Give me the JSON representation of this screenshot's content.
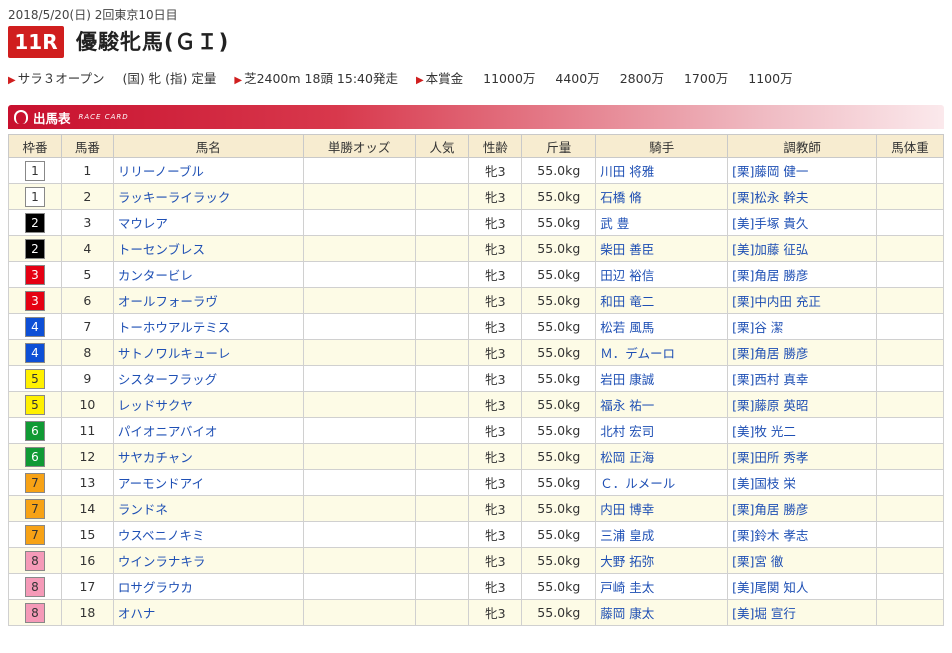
{
  "header": {
    "date_line": "2018/5/20(日) 2回東京10日目",
    "race_number": "11R",
    "race_name": "優駿牝馬(ＧＩ)"
  },
  "conditions": {
    "class": "サラ３オープン",
    "rules": "(国) 牝 (指) 定量",
    "course": "芝2400m 18頭 15:40発走",
    "prize_label": "本賞金",
    "prizes": [
      "11000万",
      "4400万",
      "2800万",
      "1700万",
      "1100万"
    ]
  },
  "section": {
    "title": "出馬表",
    "subtitle": "RACE CARD"
  },
  "columns": [
    "枠番",
    "馬番",
    "馬名",
    "単勝オッズ",
    "人気",
    "性齢",
    "斤量",
    "騎手",
    "調教師",
    "馬体重"
  ],
  "waku_colors": {
    "1": {
      "bg": "#ffffff",
      "fg": "#333333"
    },
    "2": {
      "bg": "#000000",
      "fg": "#ffffff"
    },
    "3": {
      "bg": "#e50012",
      "fg": "#ffffff"
    },
    "4": {
      "bg": "#0d4fd6",
      "fg": "#ffffff"
    },
    "5": {
      "bg": "#fff000",
      "fg": "#333333"
    },
    "6": {
      "bg": "#109a34",
      "fg": "#ffffff"
    },
    "7": {
      "bg": "#f7a215",
      "fg": "#333333"
    },
    "8": {
      "bg": "#f59ab8",
      "fg": "#333333"
    }
  },
  "entries": [
    {
      "waku": "1",
      "umaban": "1",
      "horse": "リリーノーブル",
      "odds": "",
      "pop": "",
      "sex_age": "牝3",
      "weight": "55.0kg",
      "jockey": "川田 将雅",
      "trainer": "[栗]藤岡 健一",
      "body": ""
    },
    {
      "waku": "1",
      "umaban": "2",
      "horse": "ラッキーライラック",
      "odds": "",
      "pop": "",
      "sex_age": "牝3",
      "weight": "55.0kg",
      "jockey": "石橋 脩",
      "trainer": "[栗]松永 幹夫",
      "body": ""
    },
    {
      "waku": "2",
      "umaban": "3",
      "horse": "マウレア",
      "odds": "",
      "pop": "",
      "sex_age": "牝3",
      "weight": "55.0kg",
      "jockey": "武 豊",
      "trainer": "[美]手塚 貴久",
      "body": ""
    },
    {
      "waku": "2",
      "umaban": "4",
      "horse": "トーセンブレス",
      "odds": "",
      "pop": "",
      "sex_age": "牝3",
      "weight": "55.0kg",
      "jockey": "柴田 善臣",
      "trainer": "[美]加藤 征弘",
      "body": ""
    },
    {
      "waku": "3",
      "umaban": "5",
      "horse": "カンタービレ",
      "odds": "",
      "pop": "",
      "sex_age": "牝3",
      "weight": "55.0kg",
      "jockey": "田辺 裕信",
      "trainer": "[栗]角居 勝彦",
      "body": ""
    },
    {
      "waku": "3",
      "umaban": "6",
      "horse": "オールフォーラヴ",
      "odds": "",
      "pop": "",
      "sex_age": "牝3",
      "weight": "55.0kg",
      "jockey": "和田 竜二",
      "trainer": "[栗]中内田 充正",
      "body": ""
    },
    {
      "waku": "4",
      "umaban": "7",
      "horse": "トーホウアルテミス",
      "odds": "",
      "pop": "",
      "sex_age": "牝3",
      "weight": "55.0kg",
      "jockey": "松若 風馬",
      "trainer": "[栗]谷 潔",
      "body": ""
    },
    {
      "waku": "4",
      "umaban": "8",
      "horse": "サトノワルキューレ",
      "odds": "",
      "pop": "",
      "sex_age": "牝3",
      "weight": "55.0kg",
      "jockey": "Ｍ．デムーロ",
      "trainer": "[栗]角居 勝彦",
      "body": ""
    },
    {
      "waku": "5",
      "umaban": "9",
      "horse": "シスターフラッグ",
      "odds": "",
      "pop": "",
      "sex_age": "牝3",
      "weight": "55.0kg",
      "jockey": "岩田 康誠",
      "trainer": "[栗]西村 真幸",
      "body": ""
    },
    {
      "waku": "5",
      "umaban": "10",
      "horse": "レッドサクヤ",
      "odds": "",
      "pop": "",
      "sex_age": "牝3",
      "weight": "55.0kg",
      "jockey": "福永 祐一",
      "trainer": "[栗]藤原 英昭",
      "body": ""
    },
    {
      "waku": "6",
      "umaban": "11",
      "horse": "パイオニアバイオ",
      "odds": "",
      "pop": "",
      "sex_age": "牝3",
      "weight": "55.0kg",
      "jockey": "北村 宏司",
      "trainer": "[美]牧 光二",
      "body": ""
    },
    {
      "waku": "6",
      "umaban": "12",
      "horse": "サヤカチャン",
      "odds": "",
      "pop": "",
      "sex_age": "牝3",
      "weight": "55.0kg",
      "jockey": "松岡 正海",
      "trainer": "[栗]田所 秀孝",
      "body": ""
    },
    {
      "waku": "7",
      "umaban": "13",
      "horse": "アーモンドアイ",
      "odds": "",
      "pop": "",
      "sex_age": "牝3",
      "weight": "55.0kg",
      "jockey": "Ｃ．ルメール",
      "trainer": "[美]国枝 栄",
      "body": ""
    },
    {
      "waku": "7",
      "umaban": "14",
      "horse": "ランドネ",
      "odds": "",
      "pop": "",
      "sex_age": "牝3",
      "weight": "55.0kg",
      "jockey": "内田 博幸",
      "trainer": "[栗]角居 勝彦",
      "body": ""
    },
    {
      "waku": "7",
      "umaban": "15",
      "horse": "ウスベニノキミ",
      "odds": "",
      "pop": "",
      "sex_age": "牝3",
      "weight": "55.0kg",
      "jockey": "三浦 皇成",
      "trainer": "[栗]鈴木 孝志",
      "body": ""
    },
    {
      "waku": "8",
      "umaban": "16",
      "horse": "ウインラナキラ",
      "odds": "",
      "pop": "",
      "sex_age": "牝3",
      "weight": "55.0kg",
      "jockey": "大野 拓弥",
      "trainer": "[栗]宮 徹",
      "body": ""
    },
    {
      "waku": "8",
      "umaban": "17",
      "horse": "ロサグラウカ",
      "odds": "",
      "pop": "",
      "sex_age": "牝3",
      "weight": "55.0kg",
      "jockey": "戸崎 圭太",
      "trainer": "[美]尾関 知人",
      "body": ""
    },
    {
      "waku": "8",
      "umaban": "18",
      "horse": "オハナ",
      "odds": "",
      "pop": "",
      "sex_age": "牝3",
      "weight": "55.0kg",
      "jockey": "藤岡 康太",
      "trainer": "[美]堀 宣行",
      "body": ""
    }
  ]
}
